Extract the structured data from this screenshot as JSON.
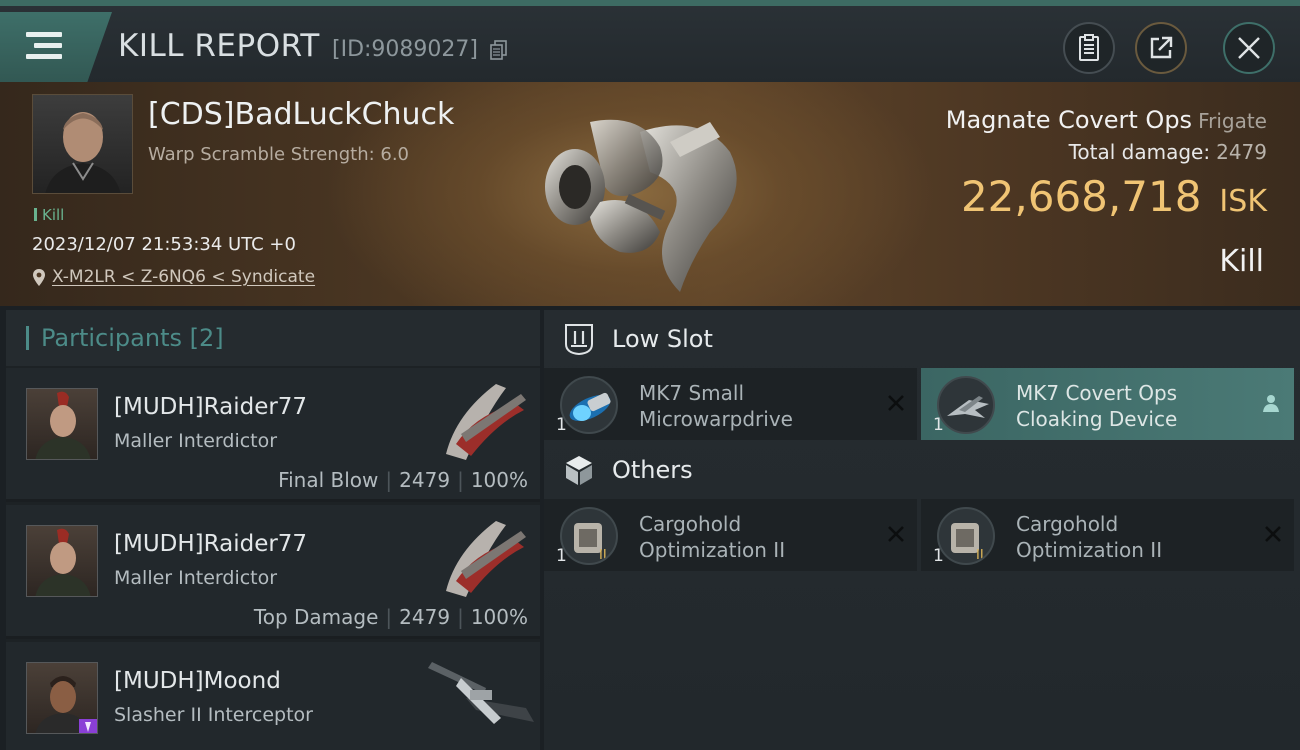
{
  "header": {
    "title": "KILL REPORT",
    "id_text": "[ID:9089027]",
    "icons": [
      "menu-icon",
      "copy-icon",
      "clipboard-icon",
      "share-icon",
      "close-icon"
    ]
  },
  "victim": {
    "name": "[CDS]BadLuckChuck",
    "warp_scramble": "Warp Scramble Strength: 6.0",
    "tag": "Kill",
    "timestamp": "2023/12/07 21:53:34 UTC +0",
    "location": "X-M2LR < Z-6NQ6 < Syndicate",
    "ship_name": "Magnate Covert Ops",
    "ship_class": "Frigate",
    "total_damage_label": "Total damage:",
    "total_damage_value": "2479",
    "isk_value": "22,668,718",
    "isk_unit": "ISK",
    "kill_type": "Kill"
  },
  "participants": {
    "label": "Participants",
    "count": "[2]",
    "items": [
      {
        "name": "[MUDH]Raider77",
        "ship": "Maller Interdictor",
        "role": "Final Blow",
        "damage": "2479",
        "percent": "100%"
      },
      {
        "name": "[MUDH]Raider77",
        "ship": "Maller Interdictor",
        "role": "Top Damage",
        "damage": "2479",
        "percent": "100%"
      },
      {
        "name": "[MUDH]Moond",
        "ship": "Slasher II Interceptor",
        "role": "",
        "damage": "",
        "percent": ""
      }
    ]
  },
  "fitting": {
    "low_slot_label": "Low Slot",
    "others_label": "Others",
    "low_slot_items": [
      {
        "line1": "MK7 Small",
        "line2": "Microwarpdrive",
        "qty": "1",
        "destroyed": true
      },
      {
        "line1": "MK7 Covert Ops",
        "line2": "Cloaking Device",
        "qty": "1",
        "destroyed": false
      }
    ],
    "others_items": [
      {
        "line1": "Cargohold",
        "line2": "Optimization II",
        "qty": "1",
        "destroyed": true
      },
      {
        "line1": "Cargohold",
        "line2": "Optimization II",
        "qty": "1",
        "destroyed": true
      }
    ]
  },
  "colors": {
    "accent_teal": "#3e6f69",
    "isk_gold": "#f0c474",
    "kill_green": "#69b38f"
  }
}
